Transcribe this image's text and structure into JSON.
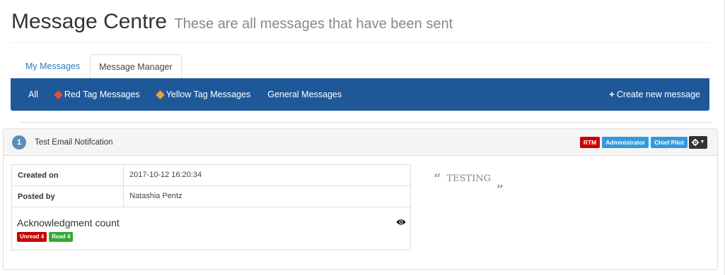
{
  "header": {
    "title": "Message Centre",
    "subtitle": "These are all messages that have been sent"
  },
  "tabs": [
    {
      "label": "My Messages",
      "active": false
    },
    {
      "label": "Message Manager",
      "active": true
    }
  ],
  "navbar": {
    "items": [
      {
        "label": "All"
      },
      {
        "label": "Red Tag Messages",
        "icon": "red-tag-icon"
      },
      {
        "label": "Yellow Tag Messages",
        "icon": "yellow-tag-icon"
      },
      {
        "label": "General Messages"
      }
    ],
    "create_label": "Create new message",
    "colors": {
      "background": "#1f5899"
    }
  },
  "message": {
    "number": "1",
    "title": "Test Email Notifcation",
    "badges": [
      {
        "label": "RTM",
        "color": "#cc0000"
      },
      {
        "label": "Administrator",
        "color": "#3399dd"
      },
      {
        "label": "Chief Pilot",
        "color": "#3399dd"
      }
    ],
    "details": [
      {
        "label": "Created on",
        "value": "2017-10-12 16:20:34"
      },
      {
        "label": "Posted by",
        "value": "Natashia Pentz"
      }
    ],
    "acknowledgment": {
      "title": "Acknowledgment count",
      "unread": "Unread 4",
      "read": "Read 4"
    },
    "body": "TESTING"
  }
}
